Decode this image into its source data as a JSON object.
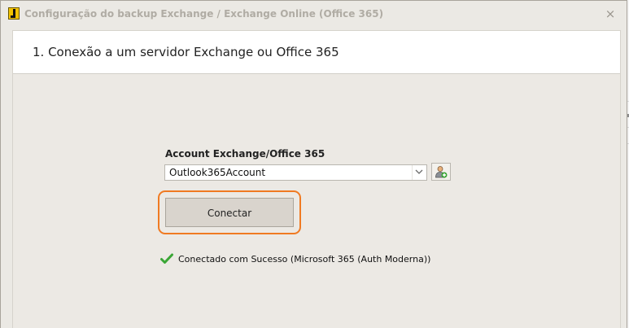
{
  "window": {
    "title": "Configuração do backup Exchange / Exchange Online (Office 365)",
    "close_symbol": "×"
  },
  "step": {
    "title": "1. Conexão a um servidor Exchange ou Office 365"
  },
  "account": {
    "label": "Account Exchange/Office 365",
    "selected": "Outlook365Account"
  },
  "connect_button": {
    "label": "Conectar"
  },
  "status": {
    "text": "Conectado com Sucesso (Microsoft 365 (Auth Moderna))",
    "icon": "check-icon",
    "color": "#3aa635"
  },
  "colors": {
    "focus_ring": "#f07a22",
    "window_bg": "#ebe9e4"
  }
}
